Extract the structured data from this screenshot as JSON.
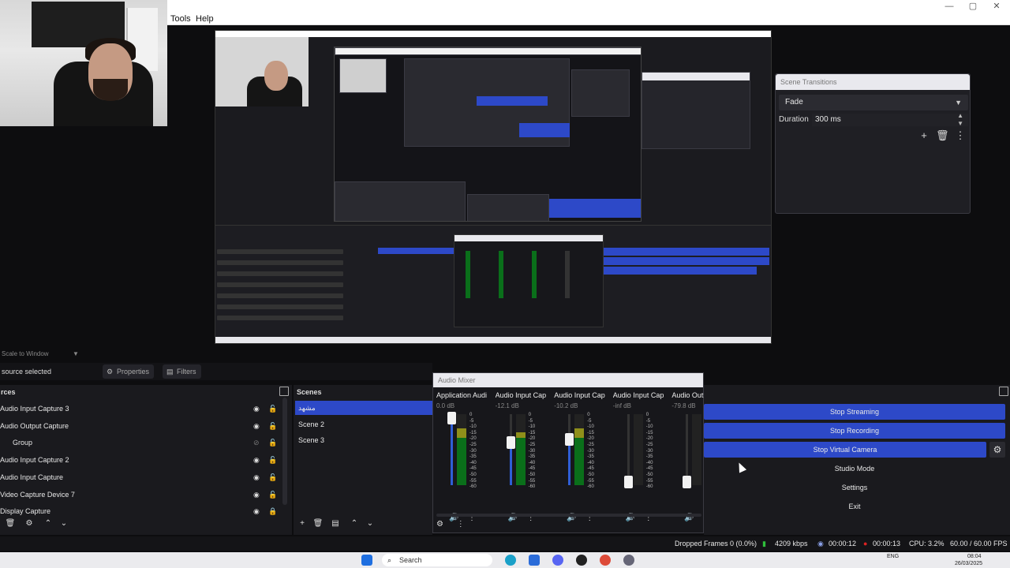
{
  "menubar": {
    "tools": "Tools",
    "help": "Help"
  },
  "scene_transitions": {
    "title": "Scene Transitions",
    "transition": "Fade",
    "duration_label": "Duration",
    "duration_value": "300 ms"
  },
  "preview": {
    "scale_mode": "Scale to Window"
  },
  "source_toolbar": {
    "status": "source selected",
    "properties": "Properties",
    "filters": "Filters"
  },
  "sources": {
    "title": "rces",
    "items": [
      {
        "label": "Audio Input Capture 3",
        "visible": true,
        "locked": false
      },
      {
        "label": "Audio Output Capture",
        "visible": true,
        "locked": false
      },
      {
        "label": "Group",
        "visible": false,
        "locked": false
      },
      {
        "label": "Audio Input Capture 2",
        "visible": true,
        "locked": false
      },
      {
        "label": "Audio Input Capture",
        "visible": true,
        "locked": false
      },
      {
        "label": "Video Capture Device 7",
        "visible": true,
        "locked": false
      },
      {
        "label": "Display Capture",
        "visible": true,
        "locked": true
      }
    ]
  },
  "scenes": {
    "title": "Scenes",
    "items": [
      {
        "label": "مشهد",
        "active": true
      },
      {
        "label": "Scene 2",
        "active": false
      },
      {
        "label": "Scene 3",
        "active": false
      }
    ]
  },
  "audio_mixer": {
    "title": "Audio Mixer",
    "channels": [
      {
        "name": "Application Audi",
        "db": "0.0 dB",
        "fader": 0.95,
        "level": 0.8
      },
      {
        "name": "Audio Input Cap",
        "db": "-12.1 dB",
        "fader": 0.6,
        "level": 0.75
      },
      {
        "name": "Audio Input Cap",
        "db": "-10.2 dB",
        "fader": 0.65,
        "level": 0.8
      },
      {
        "name": "Audio Input Cap",
        "db": "-inf dB",
        "fader": 0.05,
        "level": 0.0
      },
      {
        "name": "Audio Out",
        "db": "-79.8 dB",
        "fader": 0.05,
        "level": 0.0
      }
    ],
    "scale": [
      "0",
      "-5",
      "-10",
      "-15",
      "-20",
      "-25",
      "-30",
      "-35",
      "-40",
      "-45",
      "-50",
      "-55",
      "-60"
    ]
  },
  "controls": {
    "stop_streaming": "Stop Streaming",
    "stop_recording": "Stop Recording",
    "stop_virtual_camera": "Stop Virtual Camera",
    "studio_mode": "Studio Mode",
    "settings": "Settings",
    "exit": "Exit"
  },
  "statusbar": {
    "dropped_frames": "Dropped Frames 0 (0.0%)",
    "bitrate": "4209 kbps",
    "stream_time": "00:00:12",
    "rec_time": "00:00:13",
    "cpu": "CPU: 3.2%",
    "fps": "60.00 / 60.00 FPS"
  },
  "taskbar": {
    "search": "Search",
    "lang": "ENG",
    "time": "08:04",
    "date": "26/03/2025"
  },
  "colors": {
    "accent": "#2d49c8",
    "background": "#1a1a1e",
    "meter_green": "#0a6f1a"
  }
}
